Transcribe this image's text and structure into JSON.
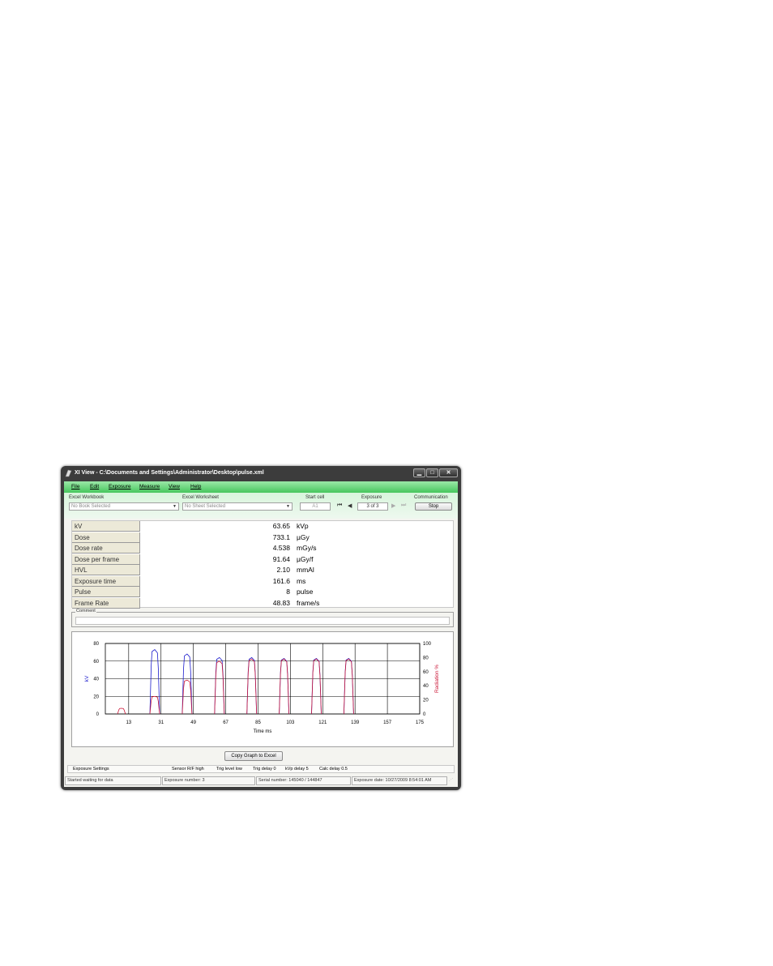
{
  "window": {
    "title": "XI View - C:\\Documents and Settings\\Administrator\\Desktop\\pulse.xml",
    "minimize": "▁",
    "maximize": "□",
    "close": "✕"
  },
  "menu": [
    "File",
    "Edit",
    "Exposure",
    "Measure",
    "View",
    "Help"
  ],
  "toolbar": {
    "workbook_label": "Excel Workbook",
    "workbook_value": "No Book Selected",
    "worksheet_label": "Excel Worksheet",
    "worksheet_value": "No Sheet Selected",
    "start_cell_label": "Start cell",
    "start_cell_value": "A1",
    "exposure_label": "Exposure",
    "exposure_value": "3 of 3",
    "communication_label": "Communication",
    "stop_label": "Stop"
  },
  "results": [
    {
      "label": "kV",
      "value": "63.65",
      "unit": "kVp"
    },
    {
      "label": "Dose",
      "value": "733.1",
      "unit": "µGy"
    },
    {
      "label": "Dose rate",
      "value": "4.538",
      "unit": "mGy/s"
    },
    {
      "label": "Dose per frame",
      "value": "91.64",
      "unit": "µGy/f"
    },
    {
      "label": "HVL",
      "value": "2.10",
      "unit": "mmAl"
    },
    {
      "label": "Exposure time",
      "value": "161.6",
      "unit": "ms"
    },
    {
      "label": "Pulse",
      "value": "8",
      "unit": "pulse"
    },
    {
      "label": "Frame Rate",
      "value": "48.83",
      "unit": "frame/s"
    }
  ],
  "comment_label": "Comment",
  "chart_data": {
    "type": "line",
    "xlabel": "Time ms",
    "ylabel": "kV",
    "y2label": "Radiation %",
    "xlim": [
      0,
      175
    ],
    "ylim": [
      0,
      80
    ],
    "y2lim": [
      0,
      100
    ],
    "x_ticks": [
      13,
      31,
      49,
      67,
      85,
      103,
      121,
      139,
      157,
      175
    ],
    "y_ticks": [
      0,
      20,
      40,
      60,
      80
    ],
    "y2_ticks": [
      0,
      20,
      40,
      60,
      80,
      100
    ],
    "series": [
      {
        "color": "#1a1acc",
        "axis": "left",
        "pulses": [
          [
            26,
            29,
            73
          ],
          [
            44,
            47,
            68
          ],
          [
            62,
            65,
            64
          ],
          [
            80,
            83,
            64
          ],
          [
            98,
            101,
            63
          ],
          [
            116,
            119,
            63
          ],
          [
            134,
            137,
            63
          ]
        ]
      },
      {
        "color": "#cc1a3a",
        "axis": "right",
        "pulses": [
          [
            8,
            10,
            8
          ],
          [
            26,
            29,
            25
          ],
          [
            44,
            47,
            48
          ],
          [
            62,
            65,
            75
          ],
          [
            80,
            83,
            78
          ],
          [
            98,
            101,
            78
          ],
          [
            116,
            119,
            78
          ],
          [
            134,
            137,
            78
          ]
        ]
      }
    ],
    "grid": true
  },
  "copy_button_label": "Copy Graph to Excel",
  "info": {
    "exposure_settings": "Exposure Settings",
    "sensor": "Sensor R/F high",
    "trig_level": "Trig level low",
    "trig_delay": "Trig delay 0",
    "kvp_delay": "kVp delay 5",
    "calc_delay": "Calc delay 0.5"
  },
  "status": {
    "message": "Started waiting for data",
    "exposure_number": "Exposure number: 3",
    "serial_number": "Serial number: 145040 / 144847",
    "exposure_date": "Exposure date: 10/27/2009  8:54:01 AM"
  }
}
